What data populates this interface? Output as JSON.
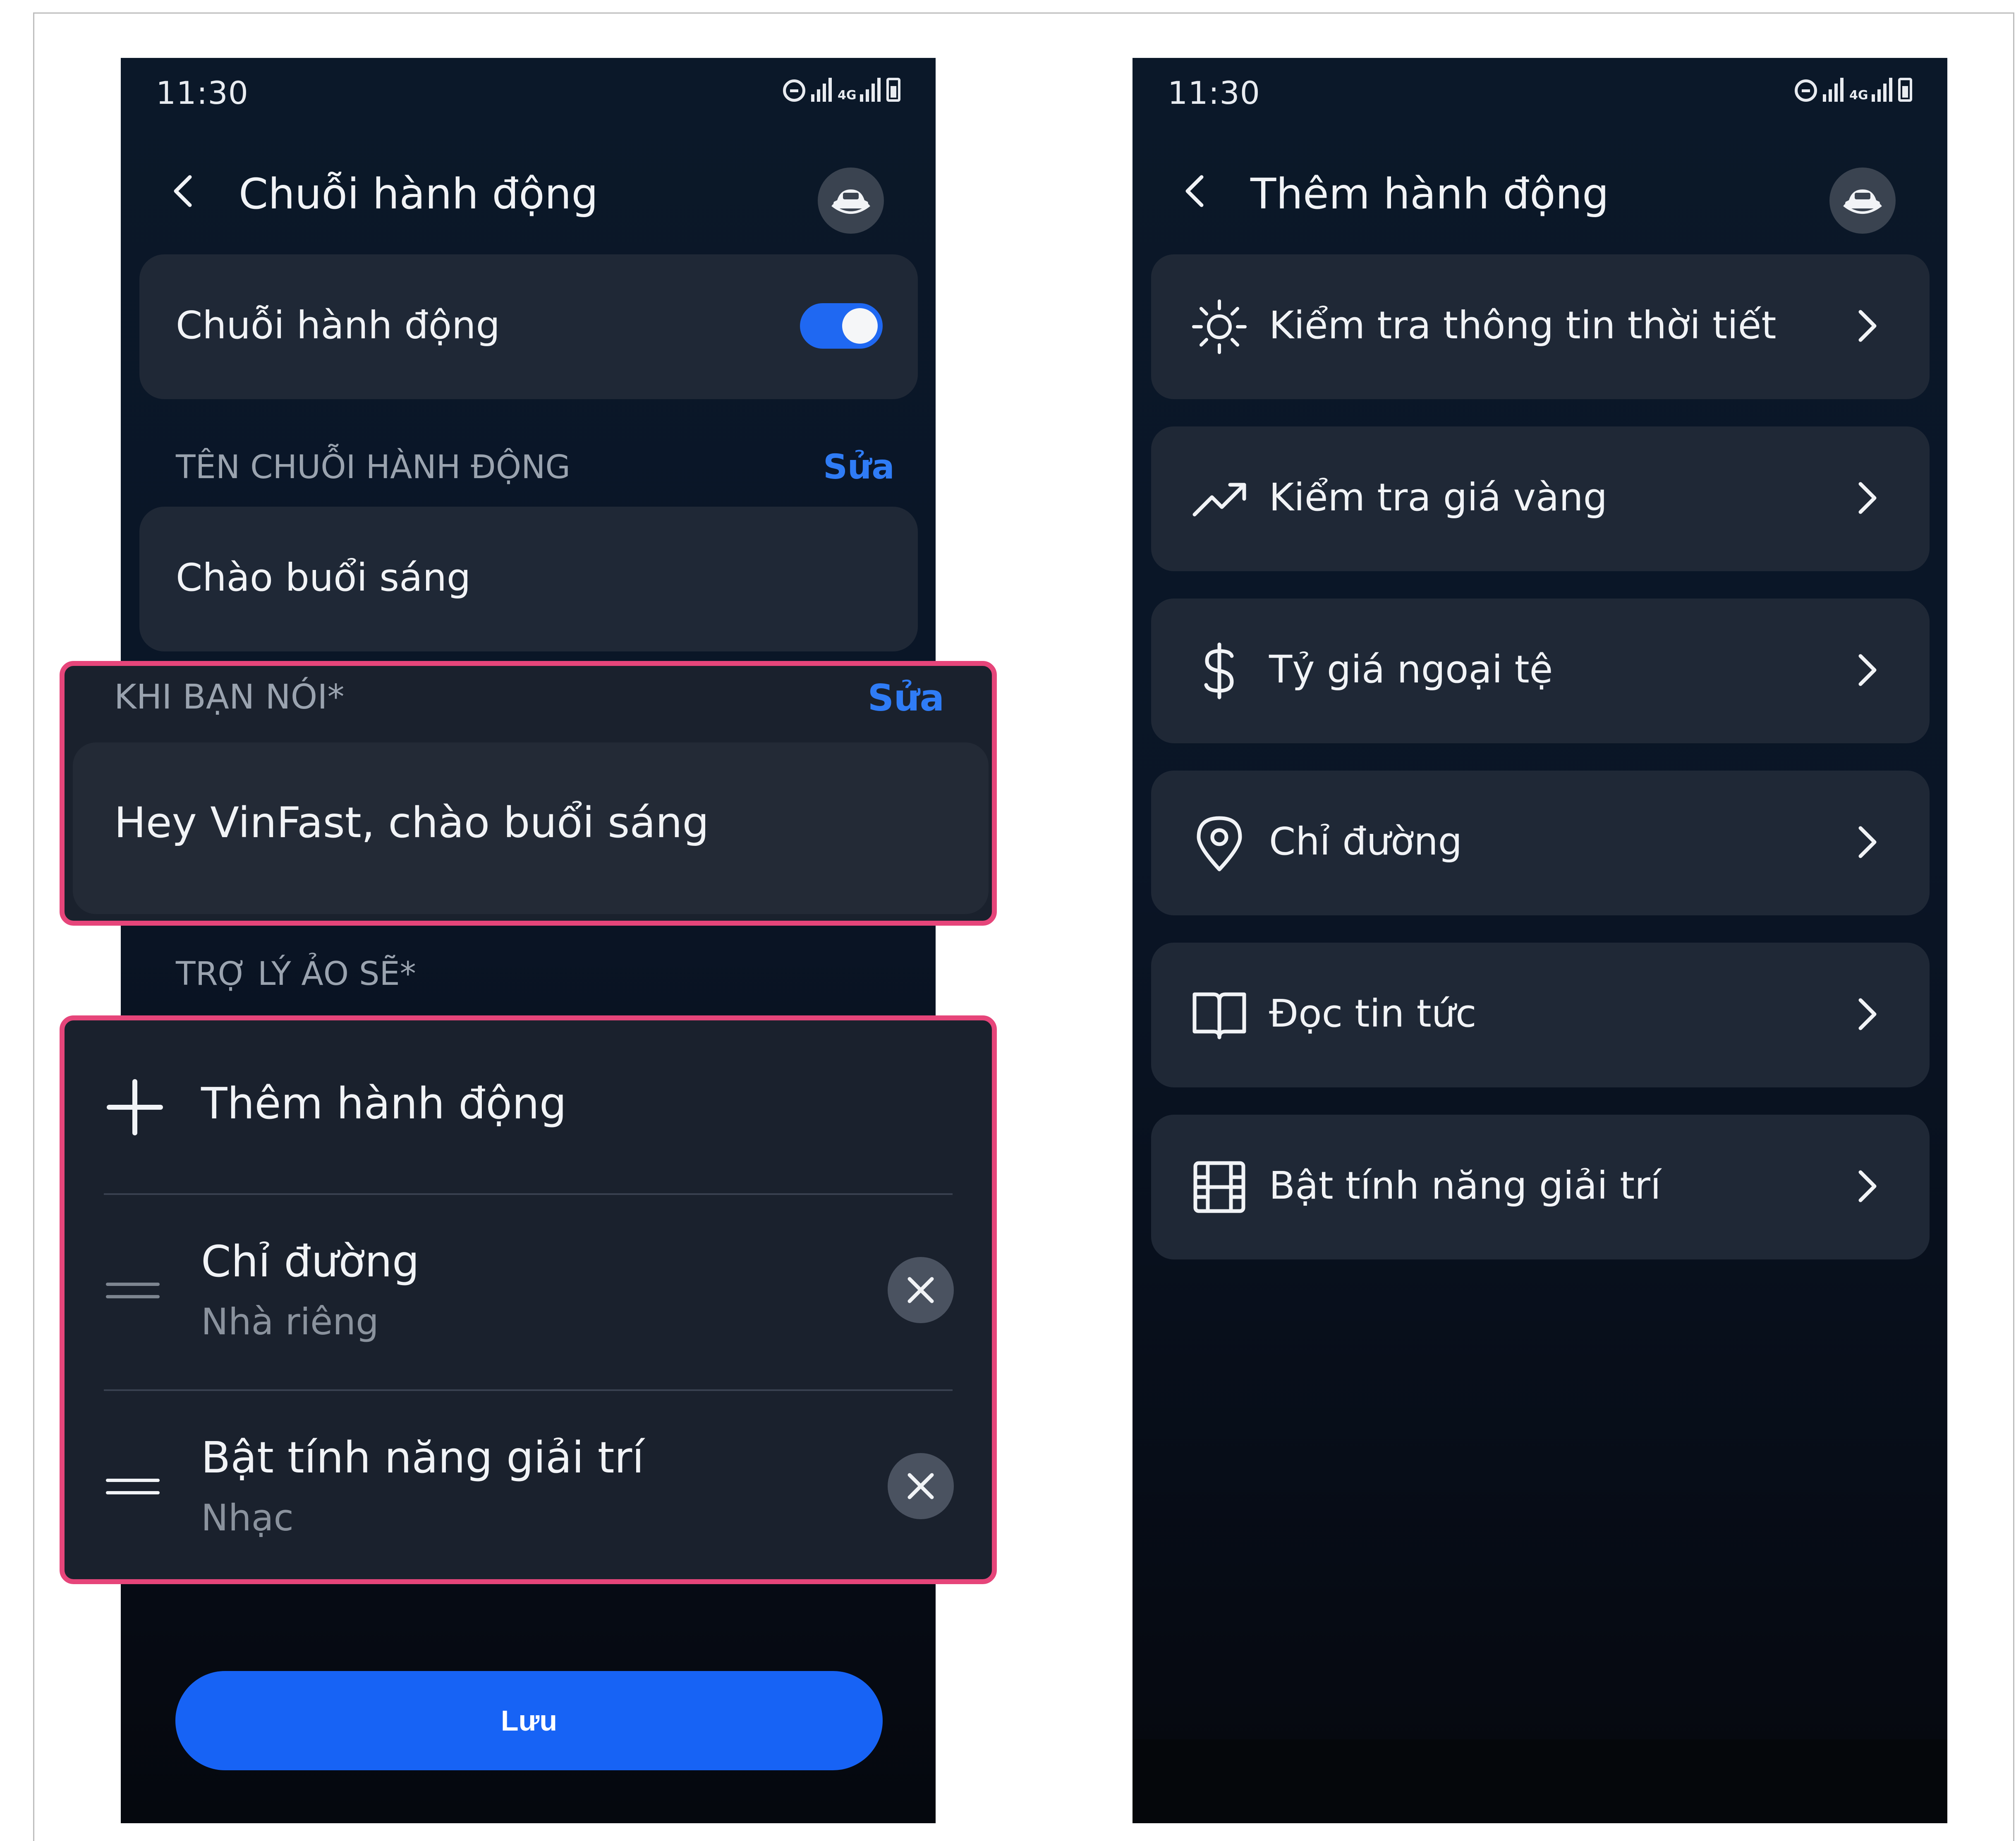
{
  "left_screen": {
    "status_time": "11:30",
    "network_label": "4G",
    "title": "Chuỗi hành động",
    "toggle": {
      "label": "Chuỗi hành động",
      "enabled": true
    },
    "name_section": {
      "label": "TÊN CHUỖI HÀNH ĐỘNG",
      "edit_label": "Sửa",
      "value": "Chào buổi sáng"
    },
    "trigger_section": {
      "label": "KHI BẠN NÓI*",
      "edit_label": "Sửa",
      "value": "Hey VinFast, chào buổi sáng"
    },
    "actions_section": {
      "label": "TRỢ LÝ ẢO SẼ*",
      "add_label": "Thêm hành động",
      "items": [
        {
          "title": "Chỉ đường",
          "subtitle": "Nhà riêng"
        },
        {
          "title": "Bật tính năng giải trí",
          "subtitle": "Nhạc"
        }
      ]
    },
    "save_label": "Lưu"
  },
  "right_screen": {
    "status_time": "11:30",
    "network_label": "4G",
    "title": "Thêm hành động",
    "menu": [
      {
        "label": "Kiểm tra thông tin thời tiết",
        "icon": "sun-icon"
      },
      {
        "label": "Kiểm tra giá vàng",
        "icon": "trend-up-icon"
      },
      {
        "label": "Tỷ giá ngoại tệ",
        "icon": "dollar-icon"
      },
      {
        "label": "Chỉ đường",
        "icon": "location-pin-icon"
      },
      {
        "label": "Đọc tin tức",
        "icon": "book-icon"
      },
      {
        "label": "Bật tính năng giải trí",
        "icon": "film-icon"
      }
    ]
  },
  "colors": {
    "background": "#0b1829",
    "card": "#1f2836",
    "accent": "#1f68f2",
    "highlight_border": "#e6457a",
    "edit_link": "#2f7cf6"
  }
}
